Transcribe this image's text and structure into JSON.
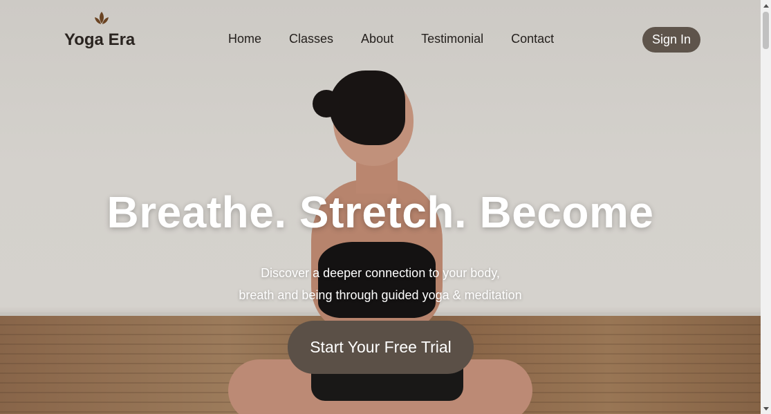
{
  "brand": {
    "name": "Yoga Era",
    "icon": "leaf-icon",
    "icon_color": "#6b4423"
  },
  "nav": {
    "items": [
      {
        "label": "Home"
      },
      {
        "label": "Classes"
      },
      {
        "label": "About"
      },
      {
        "label": "Testimonial"
      },
      {
        "label": "Contact"
      }
    ],
    "signin_label": "Sign In"
  },
  "hero": {
    "headline": "Breathe. Stretch. Become",
    "subtitle_line1": "Discover a deeper connection to your body,",
    "subtitle_line2": "breath and being through guided yoga & meditation",
    "cta_label": "Start Your Free Trial"
  },
  "colors": {
    "button_bg": "#5e544b",
    "text_dark": "#231f1c",
    "text_light": "#ffffff"
  }
}
